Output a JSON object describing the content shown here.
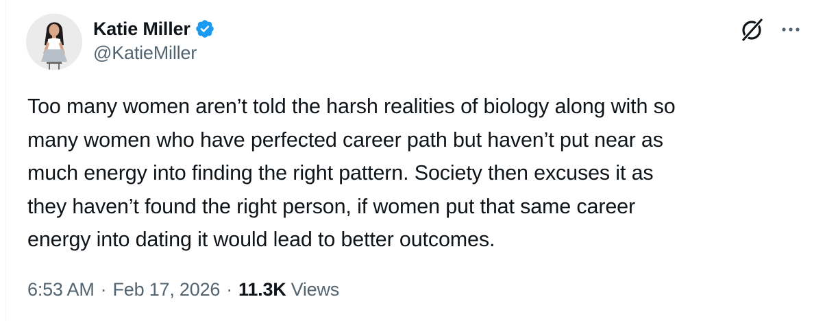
{
  "author": {
    "display_name": "Katie Miller",
    "handle": "@KatieMiller",
    "verified": true,
    "verified_color": "#1d9bf0"
  },
  "tweet": {
    "text": "Too many women aren’t told the harsh realities of biology along with so\nmany women who have perfected career path but haven’t put near as\nmuch energy into finding the right pattern. Society then excuses it as\nthey haven’t found the right person, if women put that same career\nenergy into dating it would lead to better outcomes.",
    "time": "6:53 AM",
    "date": "Feb 17, 2026",
    "separator": "·",
    "views_count": "11.3K",
    "views_label": "Views"
  },
  "icons": {
    "avatar": "profile-photo",
    "verified": "verified-badge-icon",
    "grok": "grok-icon",
    "more": "more-options-icon"
  },
  "colors": {
    "text": "#0f1419",
    "secondary": "#536471",
    "accent": "#1d9bf0"
  }
}
